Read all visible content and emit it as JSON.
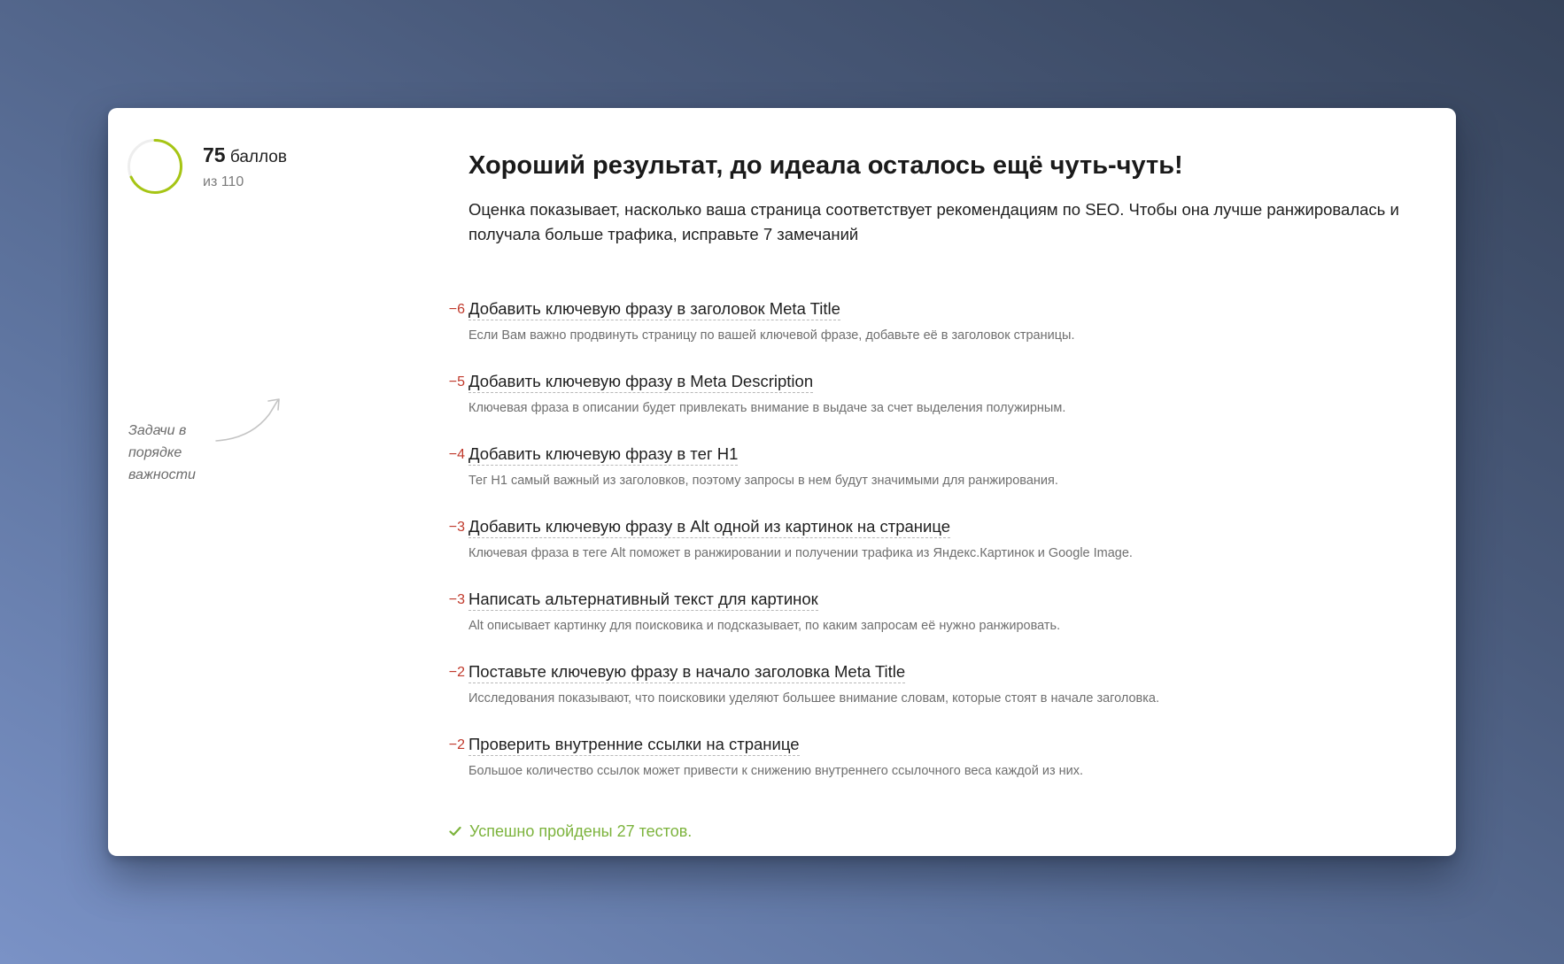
{
  "score": {
    "value": "75",
    "unit_label": "баллов",
    "out_of": "из 110",
    "progress_fraction": 0.682,
    "ring_color": "#a6c514"
  },
  "hint": {
    "lines": [
      "Задачи в",
      "порядке",
      "важности"
    ]
  },
  "header": {
    "headline": "Хороший результат, до идеала осталось ещё чуть-чуть!",
    "description": "Оценка показывает, насколько ваша страница соответствует рекомендациям по SEO. Чтобы она лучше ранжировалась и получала больше трафика, исправьте 7 замечаний"
  },
  "tasks": [
    {
      "penalty": "−6",
      "title": "Добавить ключевую фразу в заголовок Meta Title",
      "description": "Если Вам важно продвинуть страницу по вашей ключевой фразе, добавьте её в заголовок страницы."
    },
    {
      "penalty": "−5",
      "title": "Добавить ключевую фразу в Meta Description",
      "description": "Ключевая фраза в описании будет привлекать внимание в выдаче за счет выделения полужирным."
    },
    {
      "penalty": "−4",
      "title": "Добавить ключевую фразу в тег H1",
      "description": "Тег H1 самый важный из заголовков, поэтому запросы в нем будут значимыми для ранжирования."
    },
    {
      "penalty": "−3",
      "title": "Добавить ключевую фразу в Alt одной из картинок на странице",
      "description": "Ключевая фраза в теге Alt поможет в ранжировании и получении трафика из Яндекс.Картинок и Google Image."
    },
    {
      "penalty": "−3",
      "title": "Написать альтернативный текст для картинок",
      "description": "Alt описывает картинку для поисковика и подсказывает, по каким запросам её нужно ранжировать."
    },
    {
      "penalty": "−2",
      "title": "Поставьте ключевую фразу в начало заголовка Meta Title",
      "description": "Исследования показывают, что поисковики уделяют большее внимание словам, которые стоят в начале заголовка."
    },
    {
      "penalty": "−2",
      "title": "Проверить внутренние ссылки на странице",
      "description": "Большое количество ссылок может привести к снижению внутреннего ссылочного веса каждой из них."
    }
  ],
  "passed": {
    "label": "Успешно пройдены 27 тестов.",
    "icon": "check-icon",
    "color": "#7cb33c"
  },
  "colors": {
    "penalty": "#c0392b",
    "accent_ring": "#a6c514"
  }
}
